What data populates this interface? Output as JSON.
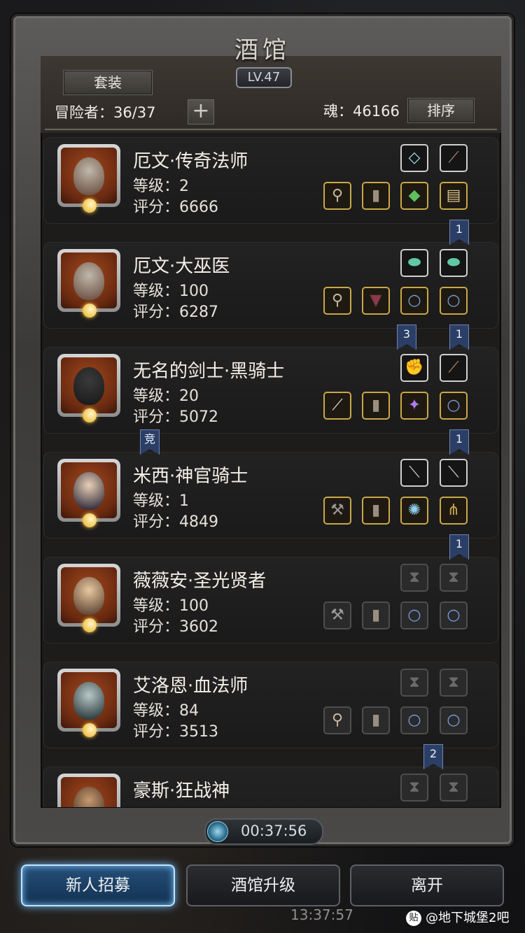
{
  "header": {
    "title": "酒馆",
    "level": "LV.47",
    "set_button": "套装",
    "adventurer_label": "冒险者：36/37",
    "add_icon": "plus-icon",
    "soul_label": "魂：46166",
    "sort_button": "排序"
  },
  "heroes": [
    {
      "name": "厄文·传奇法师",
      "level": "等级：2",
      "score": "评分：6666",
      "top_slots": [
        "bracer-icon",
        "dagger-icon"
      ],
      "bottom_slots": [
        "staff-icon",
        "armor-icon",
        "gem-icon",
        "scroll-icon"
      ],
      "ribbons": [
        "1"
      ]
    },
    {
      "name": "厄文·大巫医",
      "level": "等级：100",
      "score": "评分：6287",
      "top_slots": [
        "jade-icon",
        "jade-icon"
      ],
      "bottom_slots": [
        "staff-icon",
        "robe-icon",
        "ring-icon",
        "ring-icon"
      ],
      "ribbons": [
        "3",
        "1"
      ]
    },
    {
      "name": "无名的剑士·黑骑士",
      "level": "等级：20",
      "score": "评分：5072",
      "top_slots": [
        "gauntlet-icon",
        "dagger-icon"
      ],
      "bottom_slots": [
        "sword-icon",
        "armor-icon",
        "wand-icon",
        "ring-icon"
      ],
      "ribbons": [
        "竞",
        "1"
      ]
    },
    {
      "name": "米西·神官骑士",
      "level": "等级：1",
      "score": "评分：4849",
      "top_slots": [
        "knife-icon",
        "knife-icon"
      ],
      "bottom_slots": [
        "hammer-icon",
        "armor-icon",
        "amulet-icon",
        "claw-icon"
      ],
      "ribbons": [
        "1"
      ]
    },
    {
      "name": "薇薇安·圣光贤者",
      "level": "等级：100",
      "score": "评分：3602",
      "top_slots": [
        "hourglass-icon",
        "hourglass-icon"
      ],
      "bottom_slots": [
        "hammer-icon",
        "armor-icon",
        "ring-icon",
        "ring-icon"
      ],
      "ribbons": [
        "2"
      ]
    },
    {
      "name": "艾洛恩·血法师",
      "level": "等级：84",
      "score": "评分：3513",
      "top_slots": [
        "hourglass-icon",
        "hourglass-icon"
      ],
      "bottom_slots": [
        "staff-icon",
        "armor-icon",
        "ring-icon",
        "ring-icon"
      ],
      "ribbons": []
    },
    {
      "name": "豪斯·狂战神",
      "level": "",
      "score": "",
      "top_slots": [
        "hourglass-icon",
        "hourglass-icon"
      ],
      "bottom_slots": [],
      "ribbons": []
    }
  ],
  "timer": "00:37:56",
  "buttons": {
    "recruit": "新人招募",
    "upgrade": "酒馆升级",
    "leave": "离开"
  },
  "clock": "13:37:57",
  "watermark": "@地下城堡2吧",
  "watermark_logo": "贴",
  "colors": {
    "gold_border": "#c9a847",
    "silver_border": "#cfcfcf",
    "empty_border": "#4e4e4e",
    "active_button": "#254f78"
  }
}
